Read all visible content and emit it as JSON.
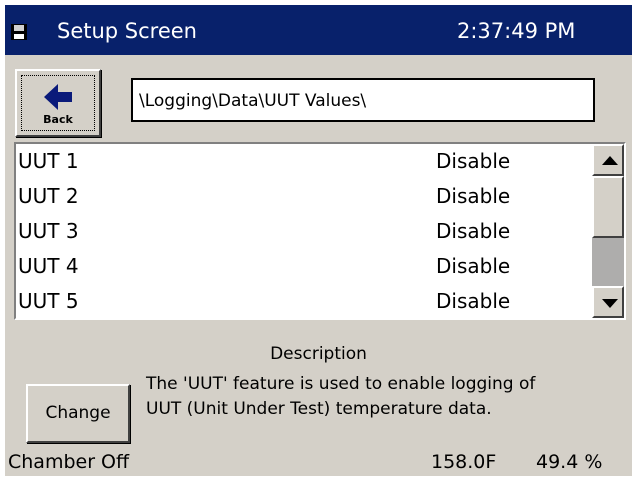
{
  "window": {
    "title": "Setup Screen",
    "time": "2:37:49 PM"
  },
  "toolbar": {
    "back_label": "Back",
    "path": "\\Logging\\Data\\UUT Values\\"
  },
  "list": {
    "items": [
      {
        "name": "UUT 1",
        "value": "Disable"
      },
      {
        "name": "UUT 2",
        "value": "Disable"
      },
      {
        "name": "UUT 3",
        "value": "Disable"
      },
      {
        "name": "UUT 4",
        "value": "Disable"
      },
      {
        "name": "UUT 5",
        "value": "Disable"
      }
    ]
  },
  "description": {
    "heading": "Description",
    "line1": "The 'UUT' feature is used to enable logging of",
    "line2": "UUT (Unit Under Test) temperature data."
  },
  "actions": {
    "change_label": "Change"
  },
  "status": {
    "chamber": "Chamber Off",
    "temperature": "158.0F",
    "humidity": "49.4 %"
  },
  "colors": {
    "titlebar": "#08216b",
    "panel": "#d4d0c8",
    "back_arrow": "#0a1a7a"
  }
}
